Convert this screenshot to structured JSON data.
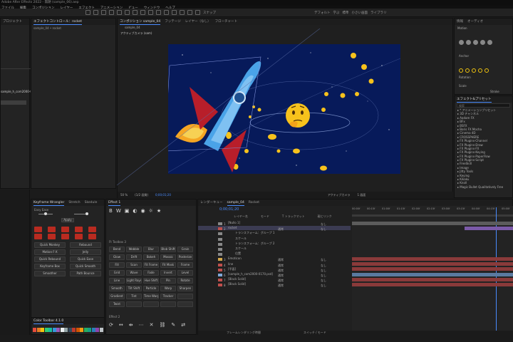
{
  "window": {
    "title": "Adobe After Effects 2022 - 無題 (sample_06).aep",
    "menu": [
      "ファイル",
      "編集",
      "コンポジション",
      "レイヤー",
      "エフェクト",
      "アニメーション",
      "ビュー",
      "ウィンドウ",
      "ヘルプ"
    ]
  },
  "toolbar": {
    "items_text": [
      "スナップ",
      "デフォルト",
      "学ぶ",
      "標準",
      "小さい画面",
      "ライブラリ"
    ]
  },
  "project_panel": {
    "tab": "プロジェクト",
    "selected_item": "sample_h_com2000-0170.psd"
  },
  "effect_controls": {
    "tab": "エフェクトコントロール：rocket",
    "subtitle": "sample_04 • rocket"
  },
  "composition": {
    "tab": "コンポジション sample_04",
    "tabs": [
      "フッテージ",
      "レイヤー（なし）",
      "フローチャート"
    ],
    "sub_tab": "sample_04",
    "active_camera": "アクティブカメラ (sam)",
    "zoom": "50 %",
    "quality": "(1/2 画質)",
    "time": "0;00;01;20",
    "view_menu": "アクティブカメラ",
    "views": "1 画面"
  },
  "right_panel": {
    "tabs": [
      "情報",
      "オーディオ"
    ],
    "section1": "Motion",
    "effects_tab": "エフェクト&プリセット",
    "effects_search": "検索",
    "effects_list": [
      "* アニメーションプリセット",
      "3D チャンネル",
      "Aadam FX",
      "BFx",
      "BSFX",
      "Boris FX Mocha",
      "Cinema 4D",
      "CROSSPHERE",
      "FX Plugins-Channel",
      "FX Plugins-Draw",
      "FX Plugins-FX",
      "FX Plugins-Keying",
      "FX Plugins-PaperFlow",
      "FX Plugins-Script",
      "FreeSkill",
      "Image",
      "Jitty Tools",
      "Keying",
      "Kikaku",
      "Knoll",
      "Magic Bullet Qualitatively Free"
    ],
    "style_label": "Stroke",
    "motion_props": [
      "Anchor",
      "Rotation",
      "Scale"
    ]
  },
  "left_tools": {
    "tabs": [
      "Keyframe Wrangler",
      "Stretch",
      "Skedule"
    ],
    "labels": [
      "Easy Ease",
      "Apply"
    ],
    "red_grid_count": 10,
    "buttons": [
      "Quick Monkey",
      "Rebound",
      "Motion F-X",
      "Jelly",
      "Quick Rebound",
      "Quick Ease",
      "Keyframe Box",
      "Quick Smooth",
      "Smoother",
      "Path Bounce"
    ]
  },
  "shape_tools": {
    "title": "Effect 1",
    "glyph_labels": [
      "B",
      "W"
    ],
    "section2": "Ft Toolbox 3",
    "grid": [
      [
        "Bend",
        "Wobble",
        "Blur",
        "Blob Shift",
        "Grain"
      ],
      [
        "Glow",
        "Drift",
        "Bokeh",
        "Mosaic",
        "Posterize"
      ],
      [
        "Fill",
        "Scan",
        "Fit Frame",
        "Fit Mask",
        "Frame"
      ],
      [
        "Grid",
        "Wave",
        "Fade",
        "Invert",
        "Level"
      ],
      [
        "Line",
        "Light Rays",
        "Hue Shift",
        "Pin",
        "Rotate"
      ],
      [
        "Smooth",
        "Tilt Shift",
        "Particle",
        "Warp",
        "Sharpen"
      ],
      [
        "Gradient",
        "Tint",
        "Time Warp",
        "Tracker",
        ""
      ],
      [
        "Twist",
        "",
        "",
        "",
        ""
      ]
    ],
    "section3": "Effect 2"
  },
  "timeline": {
    "tabs": [
      "レンダーキュー",
      "sample_04",
      "Rocket"
    ],
    "timecode": "0;00;01;20",
    "columns": [
      "レイヤー名",
      "モード",
      "T トラックマット",
      "親とリンク"
    ],
    "rows": [
      {
        "num": "1",
        "name": "[Nullo 1]",
        "mode": "",
        "parent": "なし"
      },
      {
        "num": "2",
        "name": "rocket",
        "mode": "通常",
        "parent": "なし"
      },
      {
        "num": "",
        "name": "トランスフォーム：グループ 1",
        "mode": "",
        "parent": ""
      },
      {
        "num": "",
        "name": "スケール",
        "mode": "",
        "parent": ""
      },
      {
        "num": "",
        "name": "トランスフォーム：グループ 2",
        "mode": "",
        "parent": ""
      },
      {
        "num": "",
        "name": "スケール",
        "mode": "",
        "parent": ""
      },
      {
        "num": "",
        "name": "位置",
        "mode": "",
        "parent": ""
      },
      {
        "num": "3",
        "name": "Emoticon",
        "mode": "通常",
        "parent": "なし"
      },
      {
        "num": "4",
        "name": "line",
        "mode": "通常",
        "parent": "なし"
      },
      {
        "num": "5",
        "name": "[平面]",
        "mode": "通常",
        "parent": "なし"
      },
      {
        "num": "6",
        "name": "[sample_h_com2000-0170.psd]",
        "mode": "通常",
        "parent": "なし"
      },
      {
        "num": "7",
        "name": "[Black Solid]",
        "mode": "通常",
        "parent": "なし"
      },
      {
        "num": "8",
        "name": "[Black Solid]",
        "mode": "通常",
        "parent": "なし"
      }
    ],
    "ruler": [
      "00:00f",
      "00:15f",
      "01:00f",
      "01:15f",
      "02:00f",
      "02:15f",
      "03:00f",
      "03:15f",
      "04:00f",
      "04:15f",
      "05:00f"
    ],
    "footer_left": "フレームレンダリング時間",
    "footer_mid": "スイッチ / モード"
  },
  "bottom_left": {
    "tab": "Color Toolbar 4.1.0"
  },
  "colors": {
    "comp_bg": "#071a5a",
    "accent_blue": "#4a8cff",
    "bar_red": "#c0504d",
    "bar_gray": "#6b6b6b"
  }
}
